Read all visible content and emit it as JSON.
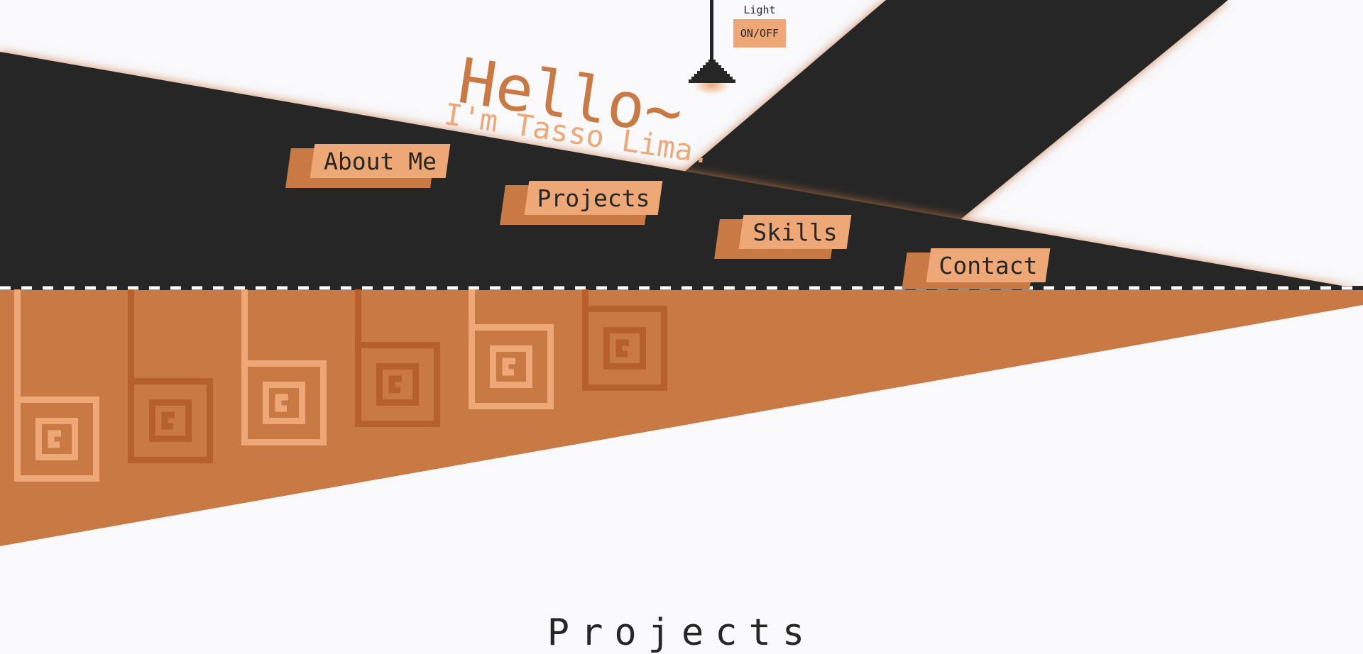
{
  "lamp": {
    "label": "Light",
    "toggle_label": "ON/OFF"
  },
  "hero": {
    "greeting": "Hello~",
    "name": "I'm Tasso Lima."
  },
  "nav": {
    "about": "About Me",
    "projects": "Projects",
    "skills": "Skills",
    "contact": "Contact"
  },
  "section": {
    "title": "Projects"
  },
  "colors": {
    "dark": "#262626",
    "accent": "#c87944",
    "accent_light": "#eea878",
    "accent_dark": "#b5602d",
    "background": "#f9f9fc"
  },
  "icons": [
    "spiral-icon"
  ]
}
